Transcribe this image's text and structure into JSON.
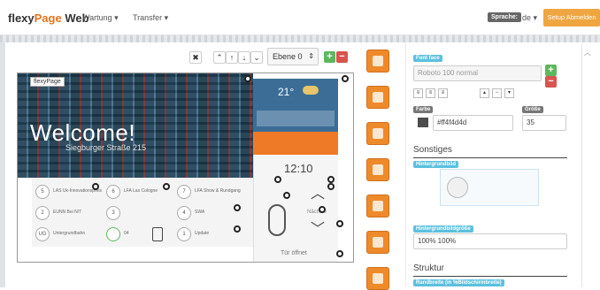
{
  "nav": {
    "brand_prefix": "flexy",
    "brand_accent": "Page",
    "brand_suffix": " Web",
    "menu_wartung": "Wartung ▾",
    "menu_transfer": "Transfer ▾",
    "lang_label": "Sprache:",
    "lang_value": "de ▾",
    "setup_button": "Setup Abmelden"
  },
  "toolbar": {
    "close": "✖",
    "up2": "⌃",
    "up": "↑",
    "down": "↓",
    "down2": "⌄",
    "layer_value": "Ebene 0",
    "layer_arrow": "⇕",
    "add": "+",
    "remove": "−"
  },
  "canvas": {
    "logo": "flexyPage",
    "welcome": "Welcome!",
    "street": "Siegburger Straße 215",
    "temp": "21°",
    "time": "12:10",
    "next_label": "Nächste",
    "door_status": "Tür öffnet",
    "grid_cells": [
      {
        "num": "5",
        "label": "LAS Uk-Innovationspreis"
      },
      {
        "num": "6",
        "label": "LFA Las Cologne"
      },
      {
        "num": "7",
        "label": "LFA Show & Rundgang"
      },
      {
        "num": "2",
        "label": "EUNN Bei N/T"
      },
      {
        "num": "3",
        "label": ""
      },
      {
        "num": "4",
        "label": "SWA"
      },
      {
        "num": "UG",
        "label": "Untergrundbahn"
      },
      {
        "num": "",
        "label": "04"
      },
      {
        "num": "1",
        "label": "Update"
      }
    ]
  },
  "panel": {
    "font_tag": "Font face",
    "font_value": "Roboto 100 normal",
    "color_tag": "Farbe",
    "color_value": "#ff4f4d4d",
    "size_tag": "Größe",
    "size_value": "35",
    "section_sonstiges": "Sonstiges",
    "bg_image_tag": "Hintergrundbild",
    "bg_size_tag": "Hintergrundbildgröße",
    "bg_size_value": "100% 100%",
    "section_struktur": "Struktur",
    "border_tag": "Randbreite (in %Bildschirmbreite)"
  },
  "colors": {
    "accent": "#ee7a28",
    "info_tag": "#5bc0de",
    "weather_bg": "#3b6d96",
    "swatch": "#4d4d4d"
  }
}
